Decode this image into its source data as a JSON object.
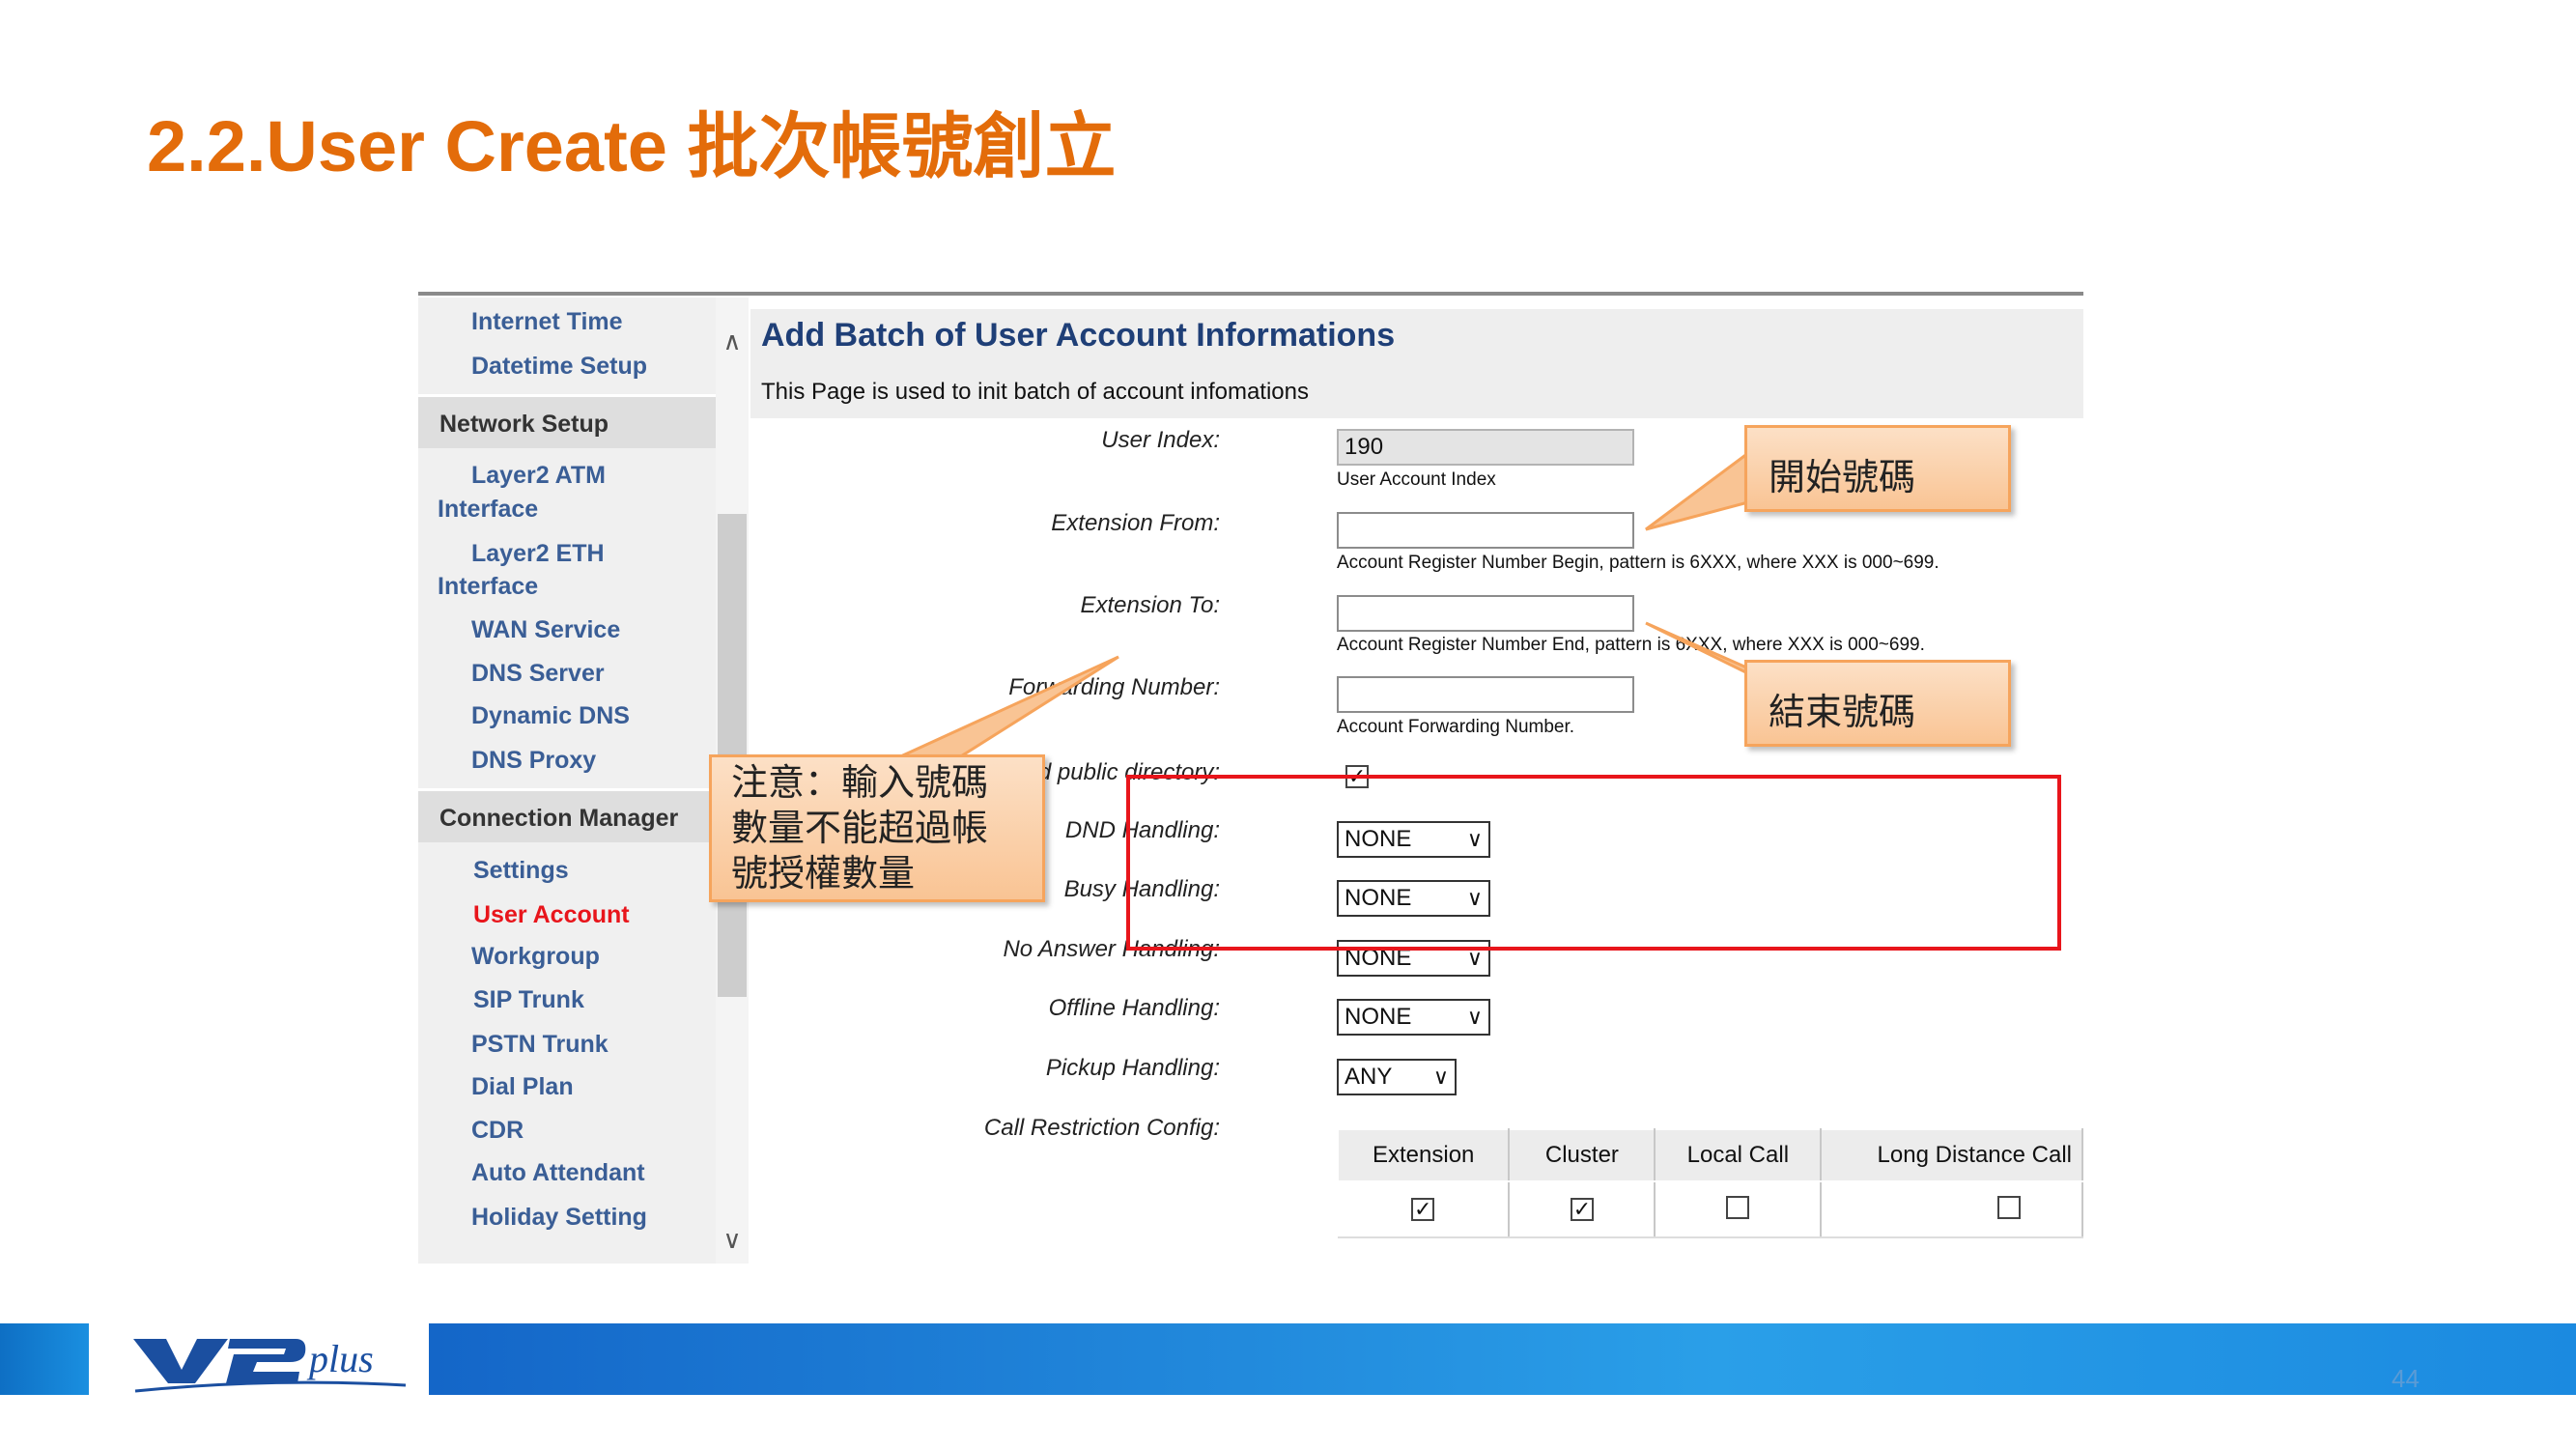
{
  "slide": {
    "title": "2.2.User Create 批次帳號創立",
    "page_number": "44",
    "logo_text": "V2plus"
  },
  "sidebar": {
    "items_top": [
      "Internet Time",
      "Datetime Setup"
    ],
    "section_network": "Network Setup",
    "network_items": [
      "Layer2 ATM",
      "Interface",
      "Layer2 ETH",
      "Interface",
      "WAN Service",
      "DNS Server",
      "Dynamic DNS",
      "DNS Proxy"
    ],
    "section_connection": "Connection Manager",
    "connection_items": [
      "Settings",
      "User Account",
      "Workgroup",
      "SIP Trunk",
      "PSTN Trunk",
      "Dial Plan",
      "CDR",
      "Auto Attendant",
      "Holiday Setting"
    ],
    "active_item": "User Account"
  },
  "main": {
    "heading": "Add Batch of User Account Informations",
    "description": "This Page is used to init batch of account infomations",
    "user_index": {
      "label": "User Index:",
      "value": "190",
      "hint": "User Account Index"
    },
    "extension_from": {
      "label": "Extension From:",
      "value": "",
      "hint": "Account Register Number Begin, pattern is 6XXX, where XXX is 000~699."
    },
    "extension_to": {
      "label": "Extension To:",
      "value": "",
      "hint": "Account Register Number End, pattern is 6XXX, where XXX is 000~699."
    },
    "forwarding": {
      "label": "Forwarding Number:",
      "value": "",
      "hint": "Account Forwarding Number."
    },
    "send_public": {
      "label": "Send public directory:",
      "checked": true
    },
    "dnd": {
      "label": "DND Handling:",
      "value": "NONE"
    },
    "busy": {
      "label": "Busy Handling:",
      "value": "NONE"
    },
    "no_answer": {
      "label": "No Answer Handling:",
      "value": "NONE"
    },
    "offline": {
      "label": "Offline Handling:",
      "value": "NONE"
    },
    "pickup": {
      "label": "Pickup Handling:",
      "value": "ANY"
    },
    "call_restriction": {
      "label": "Call Restriction Config:",
      "columns": [
        "Extension",
        "Cluster",
        "Local Call",
        "Long Distance Call"
      ],
      "checked": [
        true,
        true,
        false,
        false
      ]
    }
  },
  "callouts": {
    "start": "開始號碼",
    "end": "結束號碼",
    "note_lines": [
      "注意：輸入號碼",
      "數量不能超過帳",
      "號授權數量"
    ]
  },
  "colors": {
    "title": "#e36c0a",
    "link": "#3a5e96",
    "active": "#e8151b",
    "highlight_box": "#e8151b",
    "callout_fill": "#f9c494",
    "footer_blue": "#1466c8"
  },
  "icons": {
    "scroll_up": "chevron-up-icon",
    "scroll_down": "chevron-down-icon",
    "select_arrow": "chevron-down-icon",
    "check": "checkmark-icon"
  }
}
